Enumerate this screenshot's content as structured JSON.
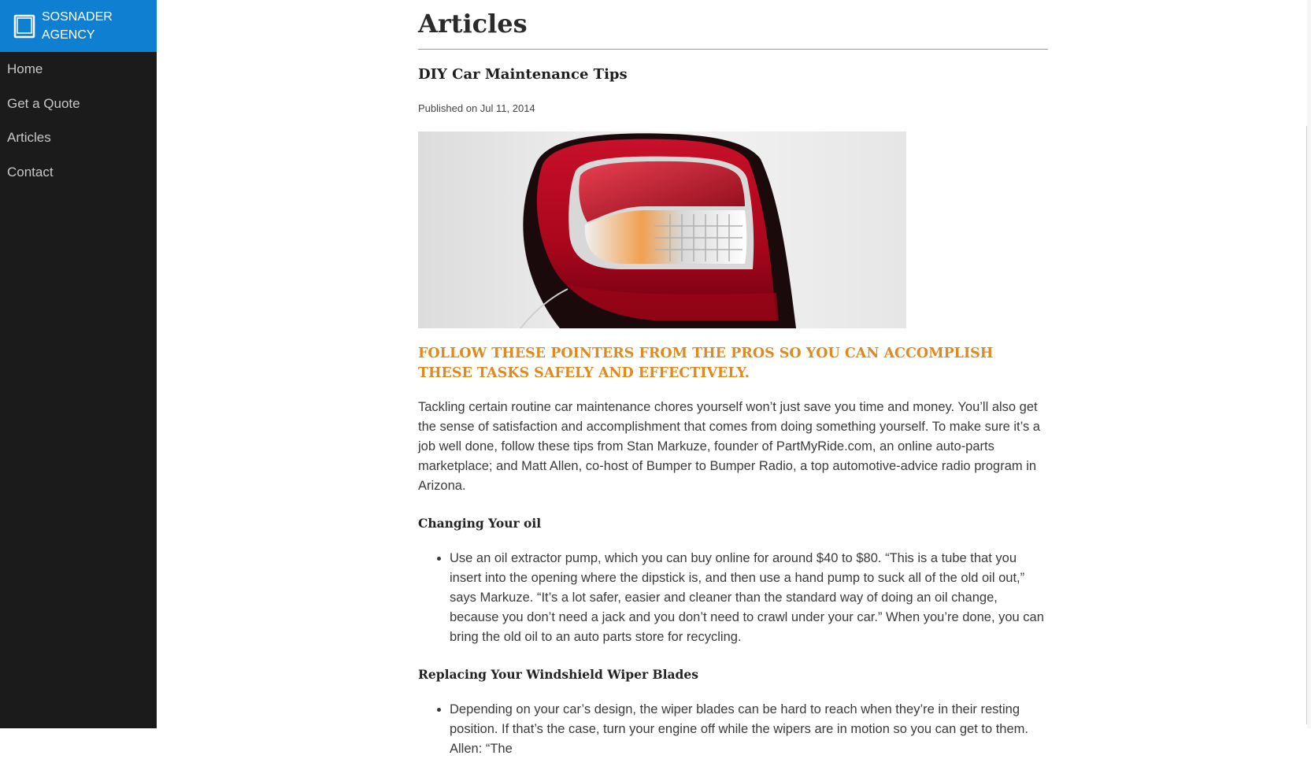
{
  "sidebar": {
    "brand_line1": "SOSNADER",
    "brand_line2": "AGENCY",
    "brand_icon": "tablet-icon",
    "items": [
      {
        "label": "Home"
      },
      {
        "label": "Get a Quote"
      },
      {
        "label": "Articles"
      },
      {
        "label": "Contact"
      }
    ]
  },
  "main": {
    "page_title": "Articles",
    "article": {
      "title": "DIY Car Maintenance Tips",
      "published": "Published on Jul 11, 2014",
      "image_alt": "car tail light",
      "subhead": "FOLLOW THESE POINTERS FROM THE PROS SO YOU CAN ACCOMPLISH THESE TASKS SAFELY AND EFFECTIVELY.",
      "intro": "Tackling certain routine car maintenance chores yourself won’t just save you time and money. You’ll also get the sense of satisfaction and accomplishment that comes from doing something yourself. To make sure it’s a job well done, follow these tips from Stan Markuze, founder of PartMyRide.com, an online auto-parts marketplace; and Matt Allen, co-host of Bumper to Bumper Radio, a top automotive-advice radio program in Arizona.",
      "section1_title": "Changing Your oil",
      "section1_bullet": "Use an oil extractor pump, which you can buy online for around $40 to $80. “This is a tube that you insert into the opening where the dipstick is, and then use a hand pump to suck all of the old oil out,” says Markuze. “It’s a lot safer, easier and cleaner than the standard way of doing an oil change, because you don’t need a jack and you don’t need to crawl under your car.” When you’re done, you can bring the old oil to an auto parts store for recycling.",
      "section2_title": "Replacing Your Windshield Wiper Blades",
      "section2_bullet": "Depending on your car’s design, the wiper blades can be hard to reach when they’re in their resting position. If that’s the case, turn your engine off while the wipers are in motion so you can get to them. Allen: “The"
    }
  },
  "colors": {
    "sidebar_bg": "#1b1b1b",
    "brand_bg": "#0f7fd2",
    "accent_orange": "#e08a1e"
  }
}
